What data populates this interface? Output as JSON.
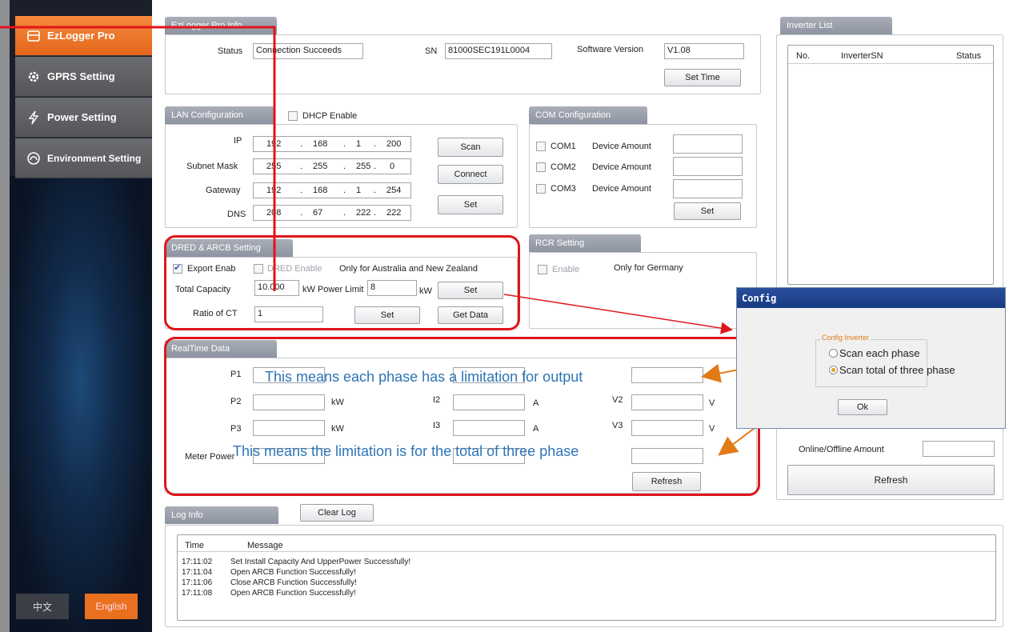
{
  "sidebar": {
    "items": [
      {
        "label": "EzLogger Pro",
        "icon": "panel-icon",
        "active": true
      },
      {
        "label": "GPRS Setting",
        "icon": "gear-icon",
        "active": false
      },
      {
        "label": "Power Setting",
        "icon": "lightning-icon",
        "active": false
      },
      {
        "label": "Environment Setting",
        "icon": "gauge-icon",
        "active": false
      }
    ],
    "lang_cn": "中文",
    "lang_en": "English"
  },
  "info": {
    "tab": "EzLogger Pro Info",
    "status_label": "Status",
    "status_value": "Connection Succeeds",
    "sn_label": "SN",
    "sn_value": "81000SEC191L0004",
    "sw_label": "Software Version",
    "sw_value": "V1.08",
    "set_time": "Set Time"
  },
  "lan": {
    "tab": "LAN Configuration",
    "dhcp": "DHCP Enable",
    "ip_label": "IP",
    "ip": [
      "192",
      "168",
      "1",
      "200"
    ],
    "mask_label": "Subnet Mask",
    "mask": [
      "255",
      "255",
      "255",
      "0"
    ],
    "gw_label": "Gateway",
    "gw": [
      "192",
      "168",
      "1",
      "254"
    ],
    "dns_label": "DNS",
    "dns": [
      "208",
      "67",
      "222",
      "222"
    ],
    "scan": "Scan",
    "connect": "Connect",
    "set": "Set"
  },
  "com": {
    "tab": "COM Configuration",
    "rows": [
      {
        "port": "COM1",
        "label": "Device Amount"
      },
      {
        "port": "COM2",
        "label": "Device Amount"
      },
      {
        "port": "COM3",
        "label": "Device Amount"
      }
    ],
    "set": "Set"
  },
  "dred": {
    "tab": "DRED & ARCB Setting",
    "export": "Export Enab",
    "dred_enable": "DRED Enable",
    "note": "Only for Australia and New Zealand",
    "capacity_label": "Total Capacity",
    "capacity_value": "10.000",
    "kw_power_limit": "kW Power Limit",
    "power_limit_value": "8",
    "kw": "kW",
    "set": "Set",
    "ratio_label": "Ratio of CT",
    "ratio_value": "1",
    "set2": "Set",
    "get_data": "Get Data"
  },
  "rcr": {
    "tab": "RCR Setting",
    "enable": "Enable",
    "note": "Only for Germany"
  },
  "realtime": {
    "tab": "RealTime Data",
    "p1": "P1",
    "p2": "P2",
    "p3": "P3",
    "i2": "I2",
    "i3": "I3",
    "v2": "V2",
    "v3": "V3",
    "kw": "kW",
    "a": "A",
    "v": "V",
    "meter_power": "Meter Power",
    "refresh": "Refresh"
  },
  "inverter": {
    "tab": "Inverter List",
    "col_no": "No.",
    "col_sn": "InverterSN",
    "col_status": "Status",
    "amount_label": "Online/Offline Amount",
    "refresh": "Refresh"
  },
  "log": {
    "tab": "Log Info",
    "clear": "Clear Log",
    "col_time": "Time",
    "col_msg": "Message",
    "rows": [
      {
        "time": "17:11:02",
        "msg": "Set Install Capacity And UpperPower Successfully!"
      },
      {
        "time": "17:11:04",
        "msg": "Open ARCB Function Successfully!"
      },
      {
        "time": "17:11:06",
        "msg": "Close ARCB Function Successfully!"
      },
      {
        "time": "17:11:08",
        "msg": "Open ARCB Function Successfully!"
      }
    ]
  },
  "config": {
    "title": "Config",
    "group": "Config Inverter",
    "opt1": "Scan each phase",
    "opt2": "Scan total of three phase",
    "selected": "Scan total of three phase",
    "ok": "Ok"
  },
  "annotations": {
    "a1": "This means each phase has a limitation for output",
    "a2": "This means the limitation is for the total of three phase"
  },
  "colors": {
    "accent_orange": "#e8701f",
    "annotation_red": "#e0151b",
    "annotation_blue": "#2e74b5",
    "arrow_orange": "#e07b18",
    "dialog_title": "#1f4590"
  }
}
